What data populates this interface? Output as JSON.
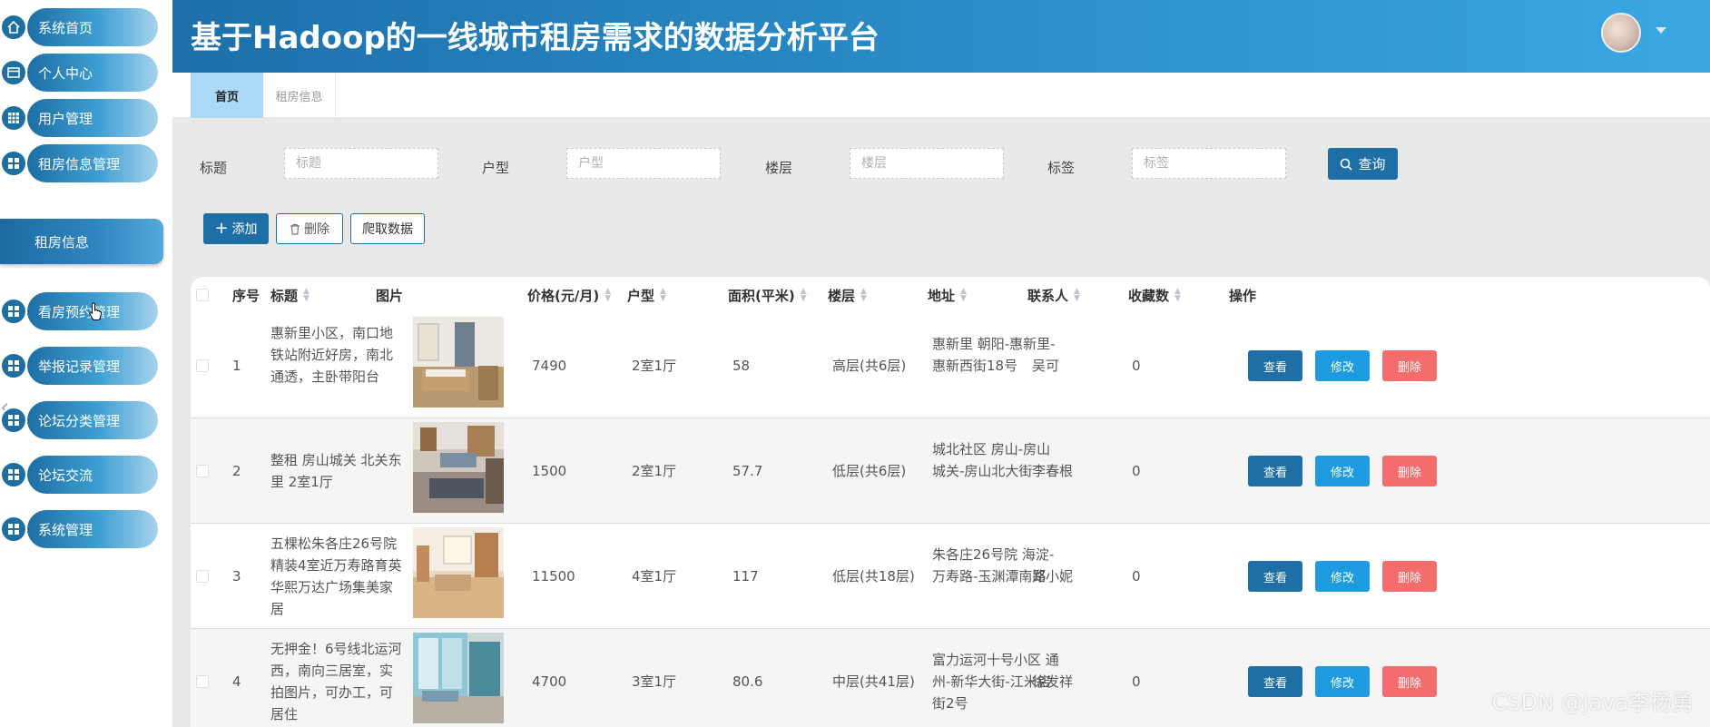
{
  "app": {
    "title": "基于Hadoop的一线城市租房需求的数据分析平台"
  },
  "sidebar": {
    "items": [
      {
        "label": "系统首页",
        "icon": "home-icon"
      },
      {
        "label": "个人中心",
        "icon": "profile-card-icon"
      },
      {
        "label": "用户管理",
        "icon": "grid-icon"
      },
      {
        "label": "租房信息管理",
        "icon": "grid-icon"
      },
      {
        "label": "看房预约管理",
        "icon": "grid-icon"
      },
      {
        "label": "举报记录管理",
        "icon": "grid-icon"
      },
      {
        "label": "论坛分类管理",
        "icon": "grid-icon"
      },
      {
        "label": "论坛交流",
        "icon": "grid-icon"
      },
      {
        "label": "系统管理",
        "icon": "grid-icon"
      }
    ],
    "active_sub_item": "租房信息"
  },
  "tabs": [
    {
      "label": "首页",
      "active": true
    },
    {
      "label": "租房信息",
      "active": false
    }
  ],
  "search": {
    "fields": [
      {
        "label": "标题",
        "placeholder": "标题"
      },
      {
        "label": "户型",
        "placeholder": "户型"
      },
      {
        "label": "楼层",
        "placeholder": "楼层"
      },
      {
        "label": "标签",
        "placeholder": "标签"
      }
    ],
    "button_label": "查询"
  },
  "actions": {
    "add_label": "添加",
    "delete_label": "删除",
    "crawl_label": "爬取数据"
  },
  "table": {
    "headers": {
      "index": "序号",
      "title": "标题",
      "image": "图片",
      "price": "价格(元/月)",
      "layout": "户型",
      "area": "面积(平米)",
      "floor": "楼层",
      "address": "地址",
      "contact": "联系人",
      "favorites": "收藏数",
      "ops": "操作"
    },
    "op_labels": {
      "view": "查看",
      "edit": "修改",
      "delete": "删除"
    },
    "rows": [
      {
        "index": "1",
        "title": "惠新里小区，南口地铁站附近好房，南北通透，主卧带阳台",
        "price": "7490",
        "layout": "2室1厅",
        "area": "58",
        "floor": "高层(共6层)",
        "address": "惠新里 朝阳-惠新里-惠新西街18号",
        "contact": "吴可",
        "favorites": "0"
      },
      {
        "index": "2",
        "title": "整租 房山城关 北关东里 2室1厅",
        "price": "1500",
        "layout": "2室1厅",
        "area": "57.7",
        "floor": "低层(共6层)",
        "address": "城北社区 房山-房山城关-房山北大街",
        "contact": "李春根",
        "favorites": "0"
      },
      {
        "index": "3",
        "title": "五棵松朱各庄26号院精装4室近万寿路育英华熙万达广场集美家居",
        "price": "11500",
        "layout": "4室1厅",
        "area": "117",
        "floor": "低层(共18层)",
        "address": "朱各庄26号院 海淀-万寿路-玉渊潭南路",
        "contact": "郑小妮",
        "favorites": "0"
      },
      {
        "index": "4",
        "title": "无押金！6号线北运河西，南向三居室，实拍图片，可办工，可居住",
        "price": "4700",
        "layout": "3室1厅",
        "area": "80.6",
        "floor": "中层(共41层)",
        "address": "富力运河十号小区 通州-新华大街-江米店街2号",
        "contact": "徐发祥",
        "favorites": "0"
      }
    ]
  },
  "watermark": "CSDN @java李杨勇",
  "colors": {
    "primary": "#1d6fa5",
    "edit": "#1e9be0",
    "danger": "#f56c6c",
    "header_start": "#1d70aa",
    "header_end": "#3aa7e3"
  }
}
